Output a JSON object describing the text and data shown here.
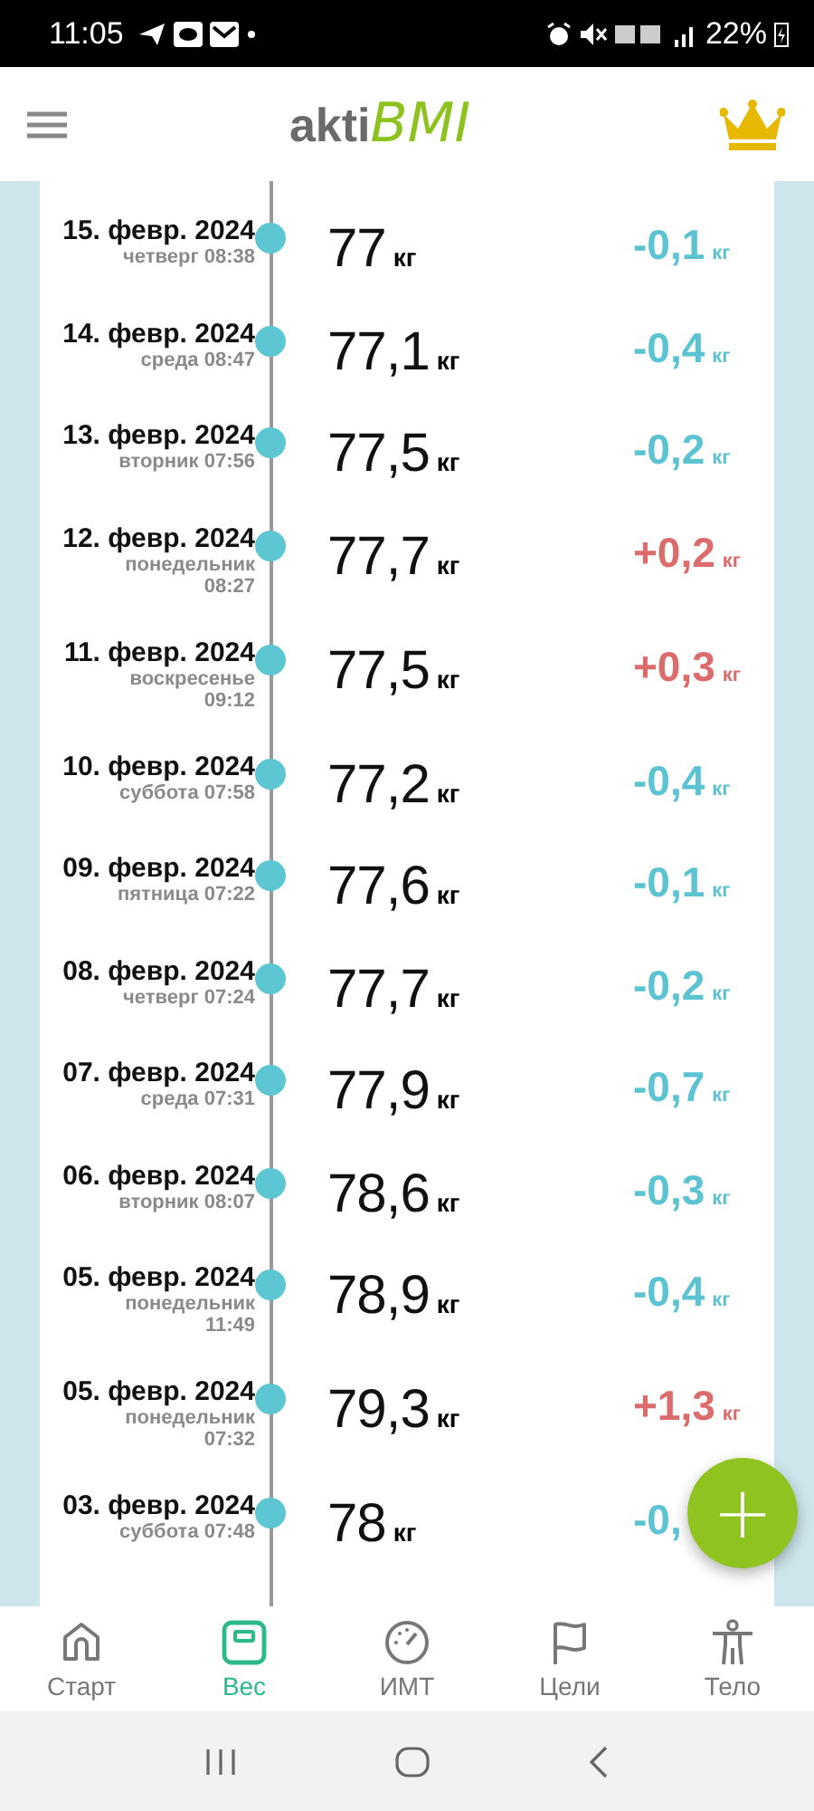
{
  "status_bar": {
    "time": "11:05",
    "battery": "22%"
  },
  "header": {
    "logo_prefix": "akti",
    "logo_suffix": "BMI"
  },
  "entries": [
    {
      "date": "15. февр. 2024",
      "weekday": "четверг",
      "time": "08:38",
      "weight": "77",
      "unit": "кг",
      "change": "-0,1",
      "change_unit": "кг",
      "color": "#5cc3d3"
    },
    {
      "date": "14. февр. 2024",
      "weekday": "среда",
      "time": "08:47",
      "weight": "77,1",
      "unit": "кг",
      "change": "-0,4",
      "change_unit": "кг",
      "color": "#5cc3d3"
    },
    {
      "date": "13. февр. 2024",
      "weekday": "вторник",
      "time": "07:56",
      "weight": "77,5",
      "unit": "кг",
      "change": "-0,2",
      "change_unit": "кг",
      "color": "#5cc3d3"
    },
    {
      "date": "12. февр. 2024",
      "weekday": "понедельник",
      "time": "08:27",
      "weight": "77,7",
      "unit": "кг",
      "change": "+0,2",
      "change_unit": "кг",
      "color": "#dc6b6b"
    },
    {
      "date": "11. февр. 2024",
      "weekday": "воскресенье",
      "time": "09:12",
      "weight": "77,5",
      "unit": "кг",
      "change": "+0,3",
      "change_unit": "кг",
      "color": "#dc6b6b"
    },
    {
      "date": "10. февр. 2024",
      "weekday": "суббота",
      "time": "07:58",
      "weight": "77,2",
      "unit": "кг",
      "change": "-0,4",
      "change_unit": "кг",
      "color": "#5cc3d3"
    },
    {
      "date": "09. февр. 2024",
      "weekday": "пятница",
      "time": "07:22",
      "weight": "77,6",
      "unit": "кг",
      "change": "-0,1",
      "change_unit": "кг",
      "color": "#5cc3d3"
    },
    {
      "date": "08. февр. 2024",
      "weekday": "четверг",
      "time": "07:24",
      "weight": "77,7",
      "unit": "кг",
      "change": "-0,2",
      "change_unit": "кг",
      "color": "#5cc3d3"
    },
    {
      "date": "07. февр. 2024",
      "weekday": "среда",
      "time": "07:31",
      "weight": "77,9",
      "unit": "кг",
      "change": "-0,7",
      "change_unit": "кг",
      "color": "#5cc3d3"
    },
    {
      "date": "06. февр. 2024",
      "weekday": "вторник",
      "time": "08:07",
      "weight": "78,6",
      "unit": "кг",
      "change": "-0,3",
      "change_unit": "кг",
      "color": "#5cc3d3"
    },
    {
      "date": "05. февр. 2024",
      "weekday": "понедельник",
      "time": "11:49",
      "weight": "78,9",
      "unit": "кг",
      "change": "-0,4",
      "change_unit": "кг",
      "color": "#5cc3d3"
    },
    {
      "date": "05. февр. 2024",
      "weekday": "понедельник",
      "time": "07:32",
      "weight": "79,3",
      "unit": "кг",
      "change": "+1,3",
      "change_unit": "кг",
      "color": "#dc6b6b"
    },
    {
      "date": "03. февр. 2024",
      "weekday": "суббота",
      "time": "07:48",
      "weight": "78",
      "unit": "кг",
      "change": "-0,",
      "color": "#5cc3d3"
    }
  ],
  "fab": {
    "label": "+"
  },
  "tabs": [
    {
      "label": "Старт",
      "selected": false
    },
    {
      "label": "Вес",
      "selected": true
    },
    {
      "label": "ИМТ",
      "selected": false
    },
    {
      "label": "Цели",
      "selected": false
    },
    {
      "label": "Тело",
      "selected": false
    }
  ]
}
